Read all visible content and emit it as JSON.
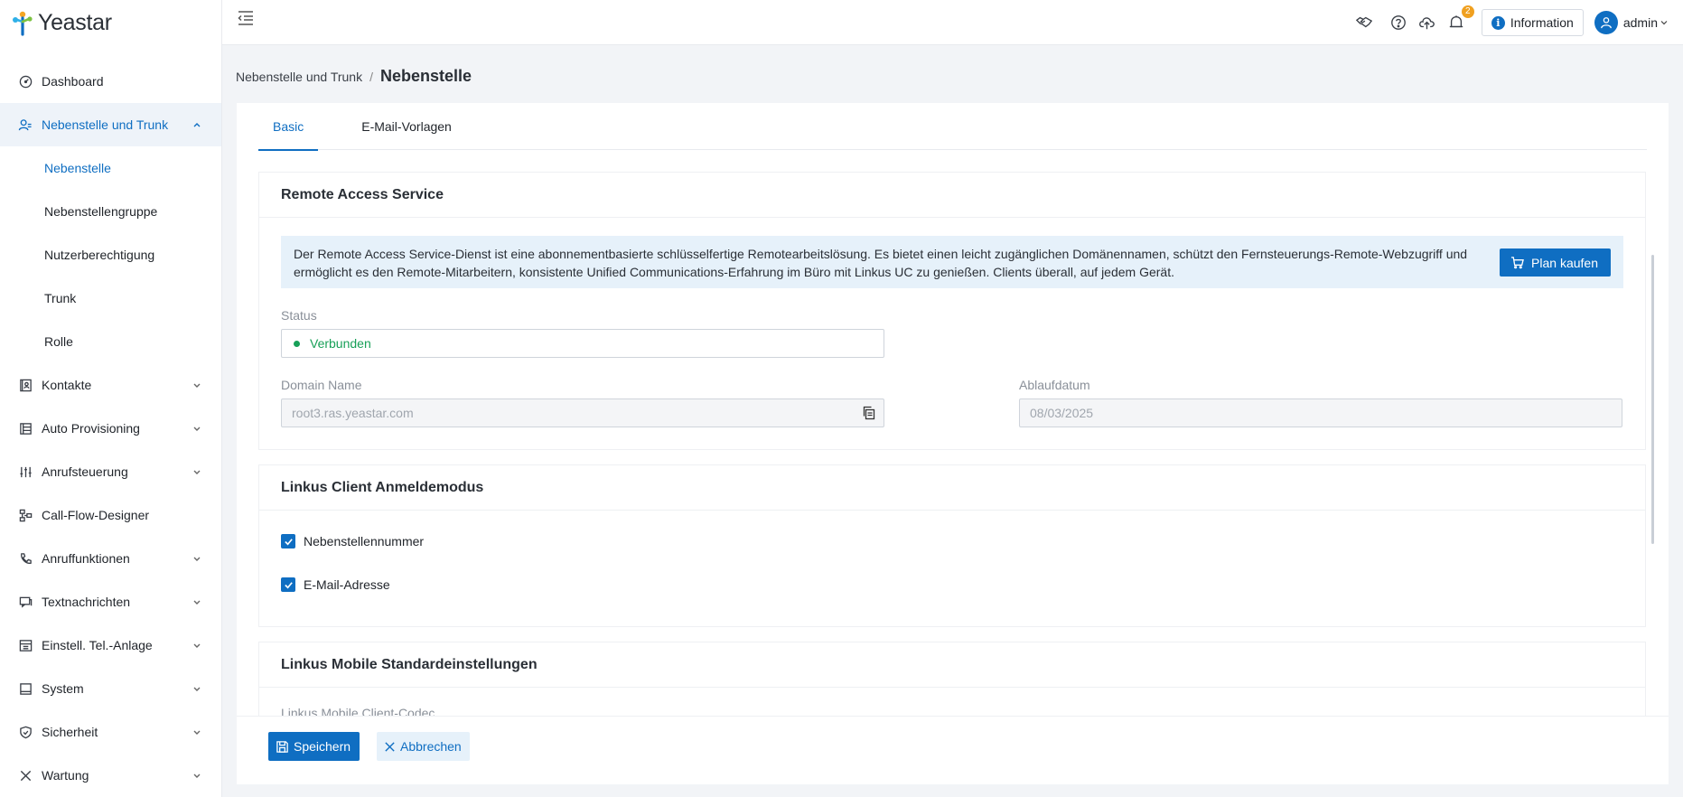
{
  "app": {
    "logo_text": "Yeastar"
  },
  "header": {
    "info_label": "Information",
    "notification_count": "2",
    "user_name": "admin"
  },
  "sidebar": {
    "items": [
      {
        "label": "Dashboard"
      },
      {
        "label": "Nebenstelle und Trunk"
      },
      {
        "label": "Kontakte"
      },
      {
        "label": "Auto Provisioning"
      },
      {
        "label": "Anrufsteuerung"
      },
      {
        "label": "Call-Flow-Designer"
      },
      {
        "label": "Anruffunktionen"
      },
      {
        "label": "Textnachrichten"
      },
      {
        "label": "Einstell. Tel.-Anlage"
      },
      {
        "label": "System"
      },
      {
        "label": "Sicherheit"
      },
      {
        "label": "Wartung"
      }
    ],
    "sub_items": [
      {
        "label": "Nebenstelle"
      },
      {
        "label": "Nebenstellengruppe"
      },
      {
        "label": "Nutzerberechtigung"
      },
      {
        "label": "Trunk"
      },
      {
        "label": "Rolle"
      }
    ]
  },
  "breadcrumb": {
    "parent": "Nebenstelle und Trunk",
    "separator": "/",
    "current": "Nebenstelle"
  },
  "tabs": [
    {
      "label": "Basic"
    },
    {
      "label": "E-Mail-Vorlagen"
    }
  ],
  "remote_access": {
    "title": "Remote Access Service",
    "notice": "Der Remote Access Service-Dienst ist eine abonnementbasierte schlüsselfertige Remotearbeitslösung. Es bietet einen leicht zugänglichen Domänennamen, schützt den Fernsteuerungs-Remote-Webzugriff und ermöglicht es den Remote-Mitarbeitern, konsistente Unified Communications-Erfahrung im Büro mit Linkus UC zu genießen. Clients überall, auf jedem Gerät.",
    "plan_button": "Plan kaufen",
    "status_label": "Status",
    "status_value": "Verbunden",
    "status_color": "#18a058",
    "domain_label": "Domain Name",
    "domain_value": "root3.ras.yeastar.com",
    "expiry_label": "Ablaufdatum",
    "expiry_value": "08/03/2025"
  },
  "linkus_login": {
    "title": "Linkus Client Anmeldemodus",
    "options": [
      {
        "label": "Nebenstellennummer",
        "checked": true
      },
      {
        "label": "E-Mail-Adresse",
        "checked": true
      }
    ]
  },
  "linkus_mobile": {
    "title": "Linkus Mobile Standardeinstellungen",
    "codec_label": "Linkus Mobile Client-Codec"
  },
  "footer": {
    "save_label": "Speichern",
    "cancel_label": "Abbrechen"
  },
  "colors": {
    "accent": "#0f6ec2",
    "notice_bg": "#e6f1fa",
    "badge": "#f0a020"
  }
}
